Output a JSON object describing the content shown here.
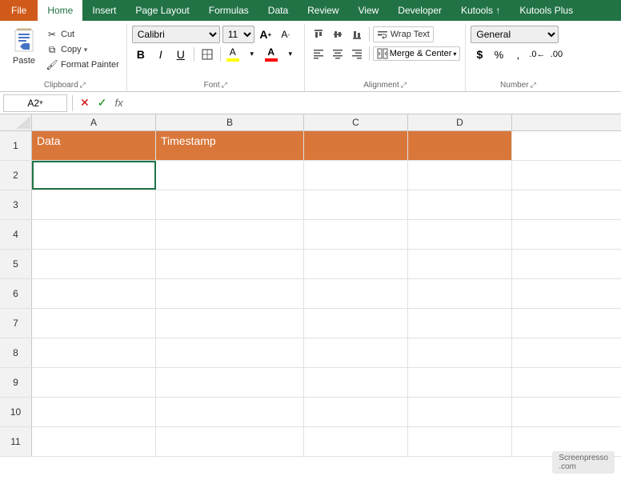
{
  "menubar": {
    "file": "File",
    "tabs": [
      "Home",
      "Insert",
      "Page Layout",
      "Formulas",
      "Data",
      "Review",
      "View",
      "Developer",
      "Kutools ↑",
      "Kutools Plus"
    ]
  },
  "ribbon": {
    "clipboard": {
      "label": "Clipboard",
      "paste": "Paste",
      "cut": "Cut",
      "copy": "Copy",
      "format_painter": "Format Painter"
    },
    "font": {
      "label": "Font",
      "font_name": "Calibri",
      "font_size": "11",
      "bold": "B",
      "italic": "I",
      "underline": "U",
      "increase_size": "A",
      "decrease_size": "A"
    },
    "alignment": {
      "label": "Alignment",
      "wrap_text": "Wrap Text",
      "merge_center": "Merge & Center"
    },
    "number": {
      "label": "Number",
      "format": "General"
    }
  },
  "formula_bar": {
    "cell_ref": "A2",
    "formula_symbol": "fx"
  },
  "spreadsheet": {
    "col_headers": [
      "A",
      "B",
      "C",
      "D"
    ],
    "rows": [
      {
        "num": 1,
        "cells": [
          "Data",
          "Timestamp",
          "",
          ""
        ]
      },
      {
        "num": 2,
        "cells": [
          "",
          "",
          "",
          ""
        ]
      },
      {
        "num": 3,
        "cells": [
          "",
          "",
          "",
          ""
        ]
      },
      {
        "num": 4,
        "cells": [
          "",
          "",
          "",
          ""
        ]
      },
      {
        "num": 5,
        "cells": [
          "",
          "",
          "",
          ""
        ]
      },
      {
        "num": 6,
        "cells": [
          "",
          "",
          "",
          ""
        ]
      },
      {
        "num": 7,
        "cells": [
          "",
          "",
          "",
          ""
        ]
      },
      {
        "num": 8,
        "cells": [
          "",
          "",
          "",
          ""
        ]
      },
      {
        "num": 9,
        "cells": [
          "",
          "",
          "",
          ""
        ]
      },
      {
        "num": 10,
        "cells": [
          "",
          "",
          "",
          ""
        ]
      },
      {
        "num": 11,
        "cells": [
          "",
          "",
          "",
          ""
        ]
      }
    ]
  },
  "watermark": "Screenpresso\n.com"
}
